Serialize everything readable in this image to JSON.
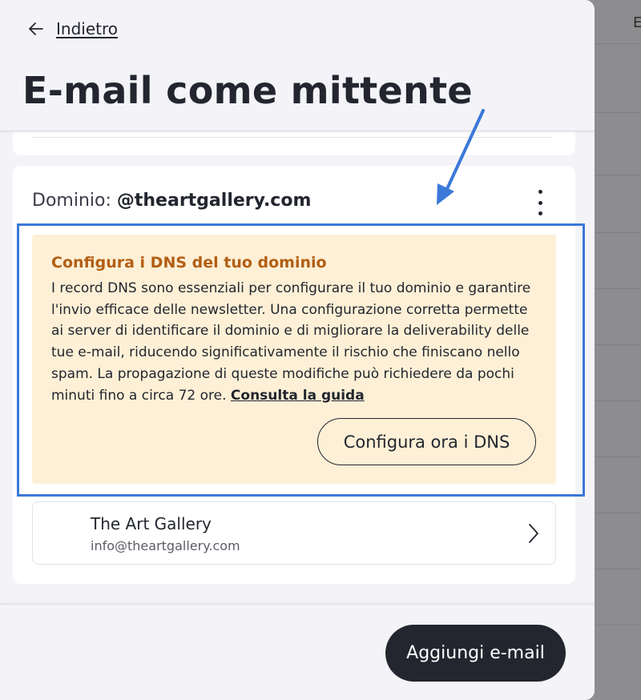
{
  "background": {
    "partial_text": "E"
  },
  "header": {
    "back_label": "Indietro",
    "title": "E-mail come mittente"
  },
  "domain": {
    "label": "Dominio:",
    "value": "@theartgallery.com"
  },
  "dns_notice": {
    "title": "Configura i DNS del tuo dominio",
    "body": "I record DNS sono essenziali per configurare il tuo dominio e garantire l'invio efficace delle newsletter. Una configurazione corretta permette ai server di identificare il dominio e di migliorare la deliverability delle tue e-mail, riducendo significativamente il rischio che finiscano nello spam. La propagazione di queste modifiche può richiedere da pochi minuti fino a circa 72 ore.",
    "guide_link": "Consulta la guida",
    "button_label": "Configura ora i DNS"
  },
  "sender": {
    "name": "The Art Gallery",
    "email": "info@theartgallery.com"
  },
  "footer": {
    "add_button_label": "Aggiungi e-mail"
  },
  "icons": {
    "back": "arrow-left-icon",
    "menu": "kebab-menu-icon",
    "chevron": "chevron-right-icon"
  },
  "colors": {
    "primary_dark": "#23262f",
    "notice_bg": "#fdf0d6",
    "notice_title": "#b35e14",
    "annotation": "#3b78d8"
  }
}
